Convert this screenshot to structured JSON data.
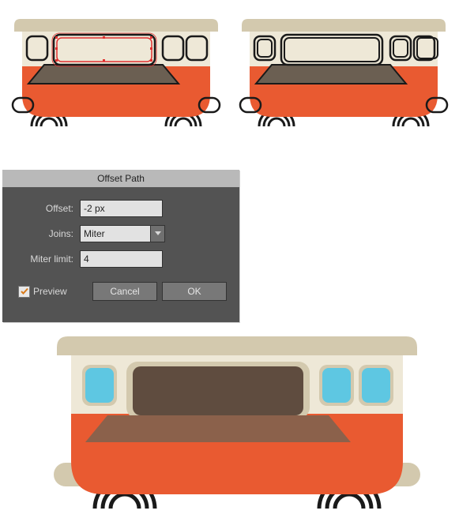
{
  "dialog": {
    "title": "Offset Path",
    "offset_label": "Offset:",
    "offset_value": "-2 px",
    "joins_label": "Joins:",
    "joins_value": "Miter",
    "miter_label": "Miter limit:",
    "miter_value": "4",
    "preview_label": "Preview",
    "preview_checked": true,
    "cancel_label": "Cancel",
    "ok_label": "OK"
  },
  "colors": {
    "orange": "#e95a31",
    "cream": "#eee8d7",
    "tan": "#d3c9ae",
    "brown_dark": "#5f4c3f",
    "brown_light": "#8b614b",
    "sky": "#5ec7e2",
    "ink": "#1a1a1a",
    "dialog_bg": "#535353",
    "field_bg": "#e2e2e2"
  }
}
